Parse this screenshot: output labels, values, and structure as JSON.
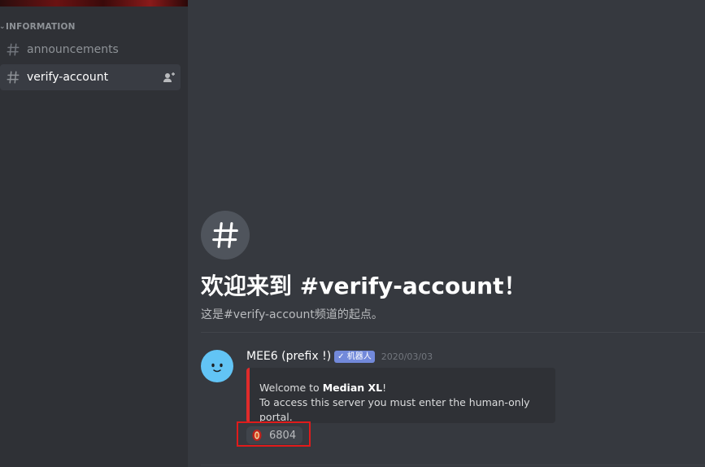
{
  "sidebar": {
    "category": "INFORMATION",
    "channels": [
      {
        "name": "announcements",
        "active": false
      },
      {
        "name": "verify-account",
        "active": true
      }
    ]
  },
  "welcome": {
    "title": "欢迎来到 #verify-account！",
    "subtitle": "这是#verify-account频道的起点。"
  },
  "message": {
    "username": "MEE6 (prefix !)",
    "bot_tag": "✓ 机器人",
    "timestamp": "2020/03/03",
    "embed": {
      "line1_prefix": "Welcome to ",
      "line1_bold": "Median XL",
      "line1_suffix": "!",
      "line2": "To access this server you must enter the human-only portal."
    },
    "reaction": {
      "count": "6804"
    }
  },
  "colors": {
    "background": "#36393f",
    "sidebar": "#2f3136",
    "embed_accent": "#e02b2b",
    "bot_tag": "#7289da",
    "highlight": "#e01b1b"
  }
}
